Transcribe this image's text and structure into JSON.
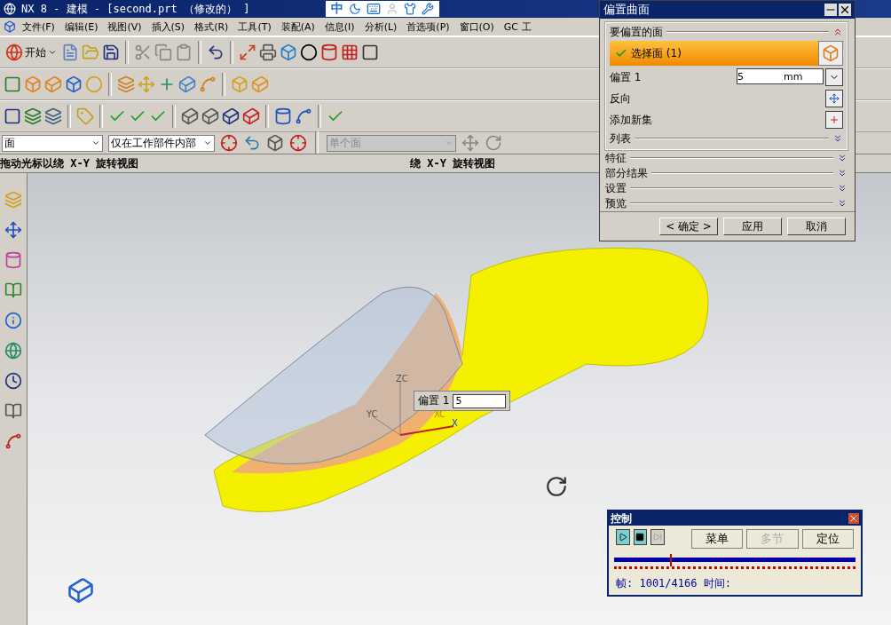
{
  "window": {
    "title": "NX 8 - 建模 - [second.prt （修改的） ]"
  },
  "ime_bar": {
    "label": "中"
  },
  "menu": [
    {
      "label": "文件(F)"
    },
    {
      "label": "编辑(E)"
    },
    {
      "label": "视图(V)"
    },
    {
      "label": "插入(S)"
    },
    {
      "label": "格式(R)"
    },
    {
      "label": "工具(T)"
    },
    {
      "label": "装配(A)"
    },
    {
      "label": "信息(I)"
    },
    {
      "label": "分析(L)"
    },
    {
      "label": "首选项(P)"
    },
    {
      "label": "窗口(O)"
    },
    {
      "label": "GC 工"
    }
  ],
  "toolbar": {
    "start_button": "开始"
  },
  "selection_bar": {
    "filter": "面",
    "scope": "仅在工作部件内部",
    "face_rule": {
      "value": "单个面",
      "disabled": true
    }
  },
  "status_bar": {
    "prompt": "拖动光标以绕 X-Y 旋转视图",
    "status": "绕 X-Y 旋转视图"
  },
  "viewport": {
    "offset_label": "偏置 1",
    "offset_value": "5",
    "axis_labels": [
      "ZC",
      "YC",
      "XC",
      "X"
    ]
  },
  "dialog": {
    "title": "偏置曲面",
    "group": {
      "label": "要偏置的面",
      "expanded": true
    },
    "select_row": {
      "label": "选择面 (1)",
      "done": true
    },
    "offset": {
      "label": "偏置 1",
      "value": "5",
      "unit": "mm"
    },
    "reverse": {
      "label": "反向"
    },
    "add_set": {
      "label": "添加新集"
    },
    "list": {
      "label": "列表",
      "expanded": false
    },
    "sections": [
      {
        "label": "特征",
        "expanded": false
      },
      {
        "label": "部分结果",
        "expanded": false
      },
      {
        "label": "设置",
        "expanded": false
      },
      {
        "label": "预览",
        "expanded": false
      }
    ],
    "buttons": [
      {
        "label": "< 确定 >"
      },
      {
        "label": "应用"
      },
      {
        "label": "取消"
      }
    ]
  },
  "control": {
    "title": "控制",
    "buttons": [
      {
        "kind": "play",
        "disabled": false
      },
      {
        "kind": "stop",
        "disabled": false
      },
      {
        "kind": "step",
        "disabled": true
      },
      {
        "kind": "text",
        "label": "菜单",
        "disabled": false
      },
      {
        "kind": "text",
        "label": "多节",
        "disabled": true
      },
      {
        "kind": "text",
        "label": "定位",
        "disabled": false
      }
    ],
    "timeline": {
      "level": 0.23
    },
    "frame": "帧: 1001/4166 时间:"
  }
}
